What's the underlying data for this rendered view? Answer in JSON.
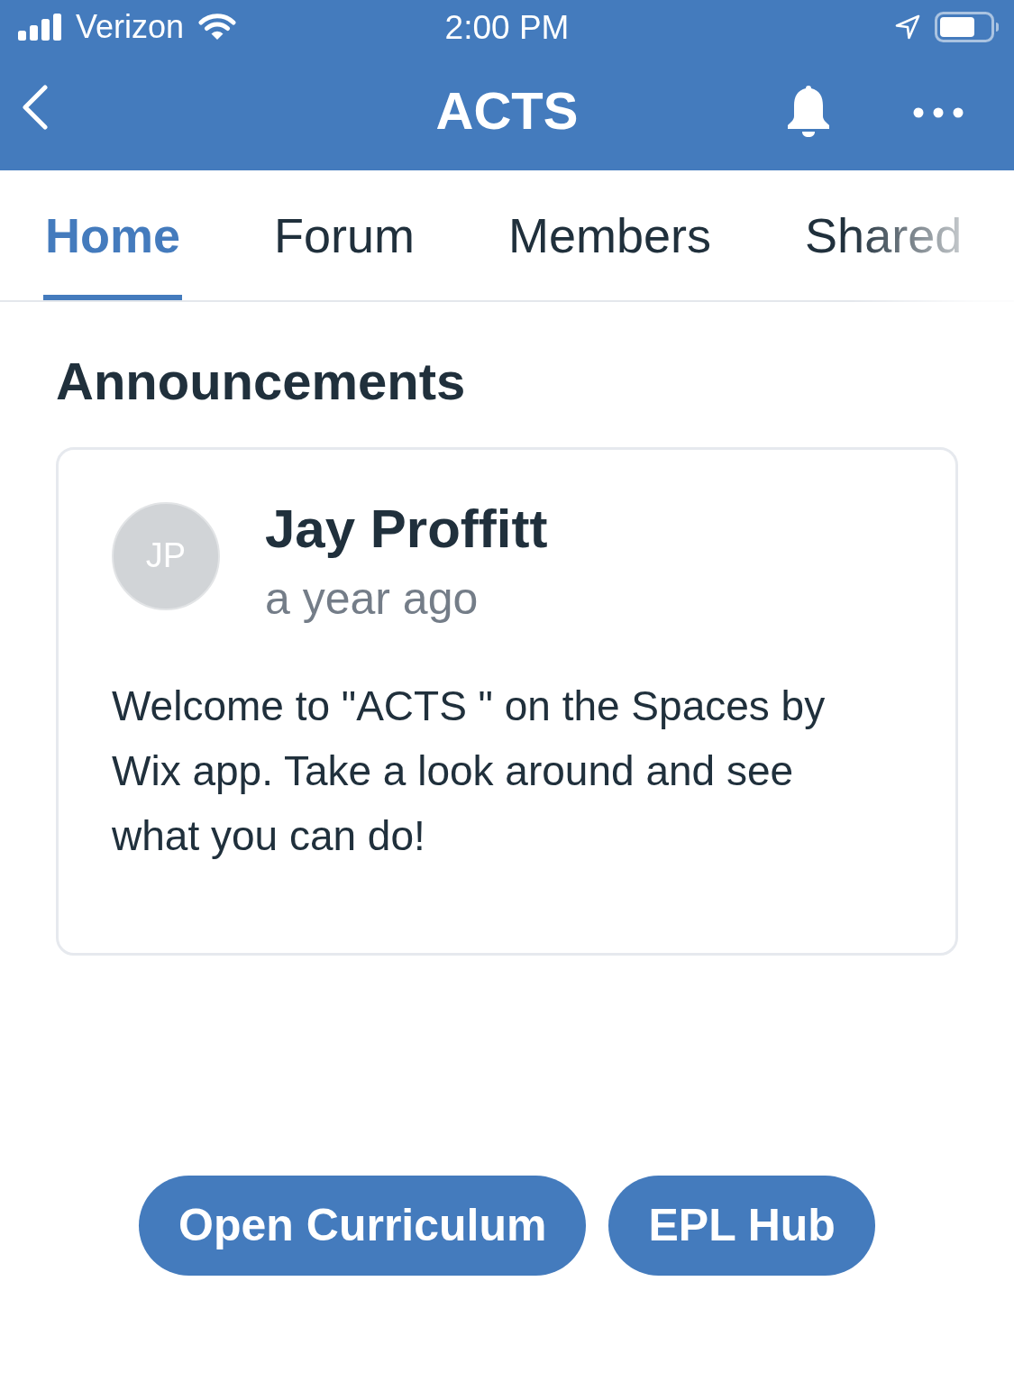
{
  "status_bar": {
    "carrier": "Verizon",
    "time": "2:00 PM"
  },
  "nav": {
    "title": "ACTS"
  },
  "tabs": [
    {
      "label": "Home",
      "selected": true
    },
    {
      "label": "Forum",
      "selected": false
    },
    {
      "label": "Members",
      "selected": false
    },
    {
      "label": "Shared",
      "selected": false
    }
  ],
  "announcements": {
    "heading": "Announcements",
    "posts": [
      {
        "initials": "JP",
        "author": "Jay Proffitt",
        "time": "a year ago",
        "body": "Welcome to \"ACTS \" on the Spaces by Wix app. Take a look around and see what you can do!"
      }
    ]
  },
  "buttons": [
    {
      "label": "Open Curriculum"
    },
    {
      "label": "EPL Hub"
    }
  ]
}
